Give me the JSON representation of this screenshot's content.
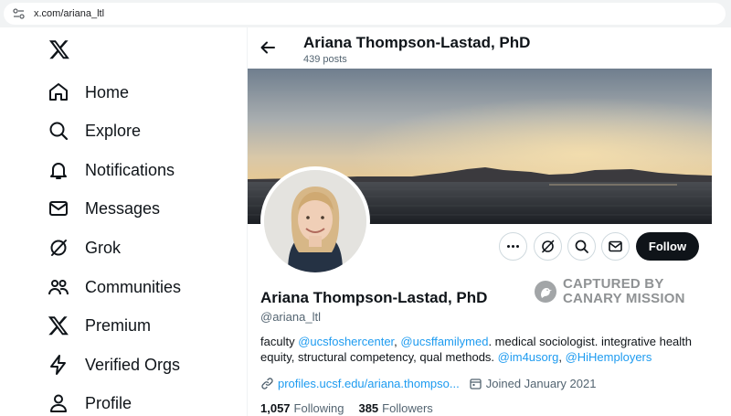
{
  "browser": {
    "url": "x.com/ariana_ltl"
  },
  "sidebar": {
    "items": [
      {
        "label": "Home",
        "icon": "home-icon"
      },
      {
        "label": "Explore",
        "icon": "search-icon"
      },
      {
        "label": "Notifications",
        "icon": "bell-icon"
      },
      {
        "label": "Messages",
        "icon": "envelope-icon"
      },
      {
        "label": "Grok",
        "icon": "grok-icon"
      },
      {
        "label": "Communities",
        "icon": "people-icon"
      },
      {
        "label": "Premium",
        "icon": "x-logo-icon"
      },
      {
        "label": "Verified Orgs",
        "icon": "lightning-icon"
      },
      {
        "label": "Profile",
        "icon": "person-icon"
      }
    ]
  },
  "header": {
    "name": "Ariana Thompson-Lastad, PhD",
    "posts": "439 posts"
  },
  "actions": {
    "follow_label": "Follow"
  },
  "watermark": {
    "line1": "CAPTURED BY",
    "line2": "CANARY MISSION"
  },
  "profile": {
    "name": "Ariana Thompson-Lastad, PhD",
    "handle": "@ariana_ltl",
    "bio": {
      "prefix": "faculty ",
      "mention1": "@ucsfoshercenter",
      "sep1": ", ",
      "mention2": "@ucsffamilymed",
      "text": ". medical sociologist. integrative health equity, structural competency, qual methods. ",
      "mention3": "@im4usorg",
      "sep2": ", ",
      "mention4": "@HiHemployers"
    },
    "website": "profiles.ucsf.edu/ariana.thompso...",
    "joined": "Joined January 2021",
    "following_count": "1,057",
    "following_label": "Following",
    "followers_count": "385",
    "followers_label": "Followers"
  },
  "colors": {
    "accent": "#1d9bf0",
    "text": "#0f1419",
    "muted": "#536471",
    "button_dark": "#0f1419"
  }
}
